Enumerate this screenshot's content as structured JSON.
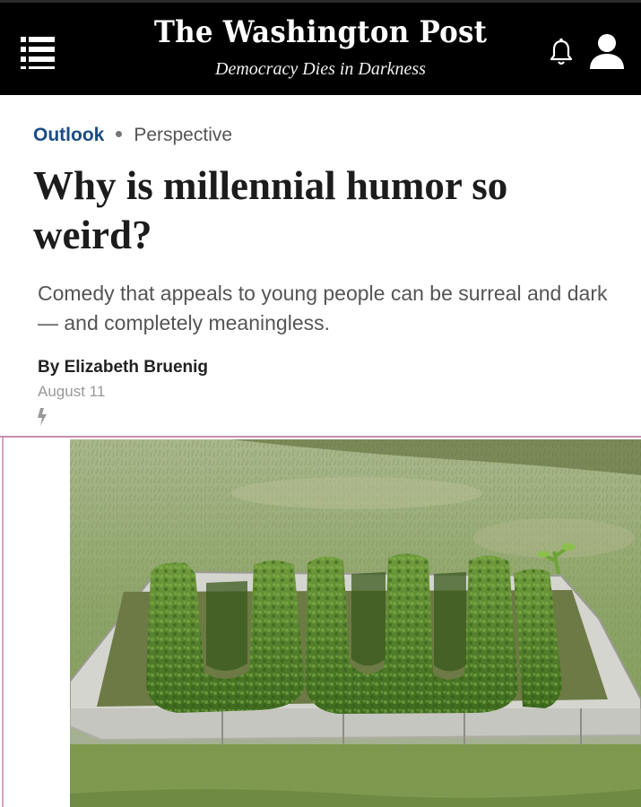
{
  "header": {
    "logo": "The Washington Post",
    "tagline": "Democracy Dies in Darkness",
    "icons": [
      "menu-icon",
      "bell-icon",
      "user-icon"
    ]
  },
  "article": {
    "section": "Outlook",
    "label": "Perspective",
    "headline": "Why is millennial humor so weird?",
    "dek": "Comedy that appeals to young people can be surreal and dark — and completely meaningless.",
    "byline_prefix": "By ",
    "author": "Elizabeth Bruenig",
    "date": "August 11",
    "amp_icon": "lightning-bolt-icon"
  },
  "photo": {
    "subject": "hedge-letters-in-garden-bed-icon"
  },
  "colors": {
    "header_bg": "#000000",
    "section_link": "#1a4c85",
    "headline": "#1c1c1c",
    "dek": "#555555"
  }
}
